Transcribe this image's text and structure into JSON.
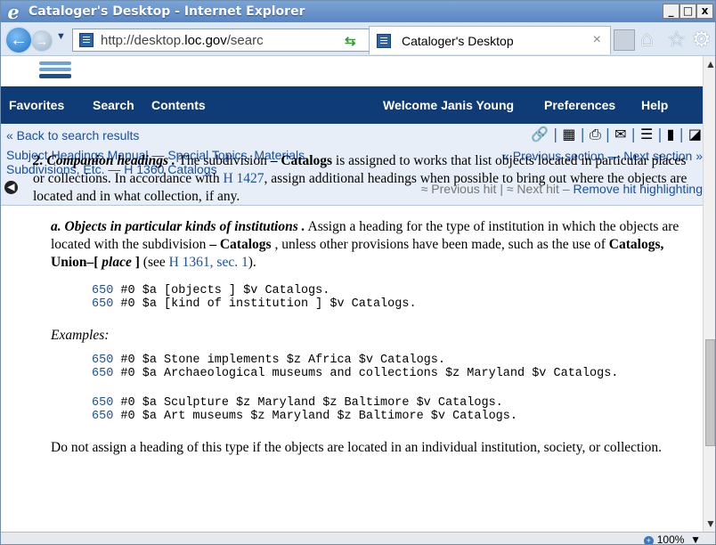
{
  "window": {
    "title": "Cataloger's Desktop - Internet Explorer",
    "min_label": "_",
    "max_label": "□",
    "close_label": "x"
  },
  "browser": {
    "url_prefix": "http://desktop.",
    "url_domain": "loc.gov",
    "url_suffix": "/searc",
    "tab_title": "Cataloger's Desktop",
    "tab_close": "×"
  },
  "menu": {
    "favorites": "Favorites",
    "search": "Search",
    "contents": "Contents",
    "welcome": "Welcome Janis Young",
    "preferences": "Preferences",
    "help": "Help"
  },
  "crumbs": {
    "back_link": "« Back to search results",
    "breadcrumb": "Subject Headings Manual — Special Topics, Materials, Subdivisions, Etc. — H 1360 Catalogs",
    "prev_section": "« Previous section",
    "sep_dash": "—",
    "next_section": "Next section »",
    "prev_hit": "≈ Previous hit",
    "hit_sep": "|",
    "next_hit": "≈ Next hit",
    "remove_dash": "–",
    "remove_hit": "Remove hit highlighting"
  },
  "doc": {
    "p1_head": "2. Companion headings .",
    "p1_a": " The subdivision ",
    "p1_sub": "– Catalogs",
    "p1_b": " is assigned to works that list objects located in particular places or collections. In accordance with ",
    "p1_link": "H 1427",
    "p1_c": ", assign additional headings when possible to bring out where the objects are located and in what collection, if any.",
    "p2_head": "a. Objects in particular kinds of institutions .",
    "p2_a": " Assign a heading for the type of institution in which the objects are located with the subdivision ",
    "p2_sub": "– Catalogs",
    "p2_b": " , unless other provisions have been made, such as the use of ",
    "p2_bold": "Catalogs, Union–[",
    "p2_place": " place ",
    "p2_close": "]",
    "p2_c": " (see ",
    "p2_link": "H 1361, sec. 1",
    "p2_d": ").",
    "code1": [
      {
        "tag": "650",
        "text": " #0 $a [objects ] $v Catalogs."
      },
      {
        "tag": "650",
        "text": " #0 $a [kind of institution ] $v Catalogs."
      }
    ],
    "examples_label": "Examples:",
    "code2": [
      {
        "tag": "650",
        "text": " #0 $a Stone implements $z Africa $v Catalogs."
      },
      {
        "tag": "650",
        "text": " #0 $a Archaeological museums and collections $z Maryland $v Catalogs."
      }
    ],
    "code3": [
      {
        "tag": "650",
        "text": " #0 $a Sculpture $z Maryland $z Baltimore $v Catalogs."
      },
      {
        "tag": "650",
        "text": " #0 $a Art museums $z Maryland $z Baltimore $v Catalogs."
      }
    ],
    "p3": "Do not assign a heading of this type if the objects are located in an individual institution, society, or collection."
  },
  "status": {
    "zoom": "100%",
    "zoom_drop": "▼"
  },
  "icons": {
    "ie_logo": "ie-logo-icon",
    "back": "back-arrow-icon",
    "forward": "forward-arrow-icon",
    "search": "search-icon",
    "refresh": "refresh-icon",
    "home": "home-icon",
    "favorites": "star-icon",
    "settings": "gear-icon",
    "link": "link-icon",
    "print": "print-icon",
    "email": "email-icon",
    "list": "list-icon",
    "bookmark": "bookmark-icon",
    "collapse": "circle-arrow-icon"
  },
  "colors": {
    "menubar": "#0f3c76",
    "link": "#1a4fa3",
    "crumb_bg": "#e7eef7",
    "titlebar": "#5b86c2"
  }
}
